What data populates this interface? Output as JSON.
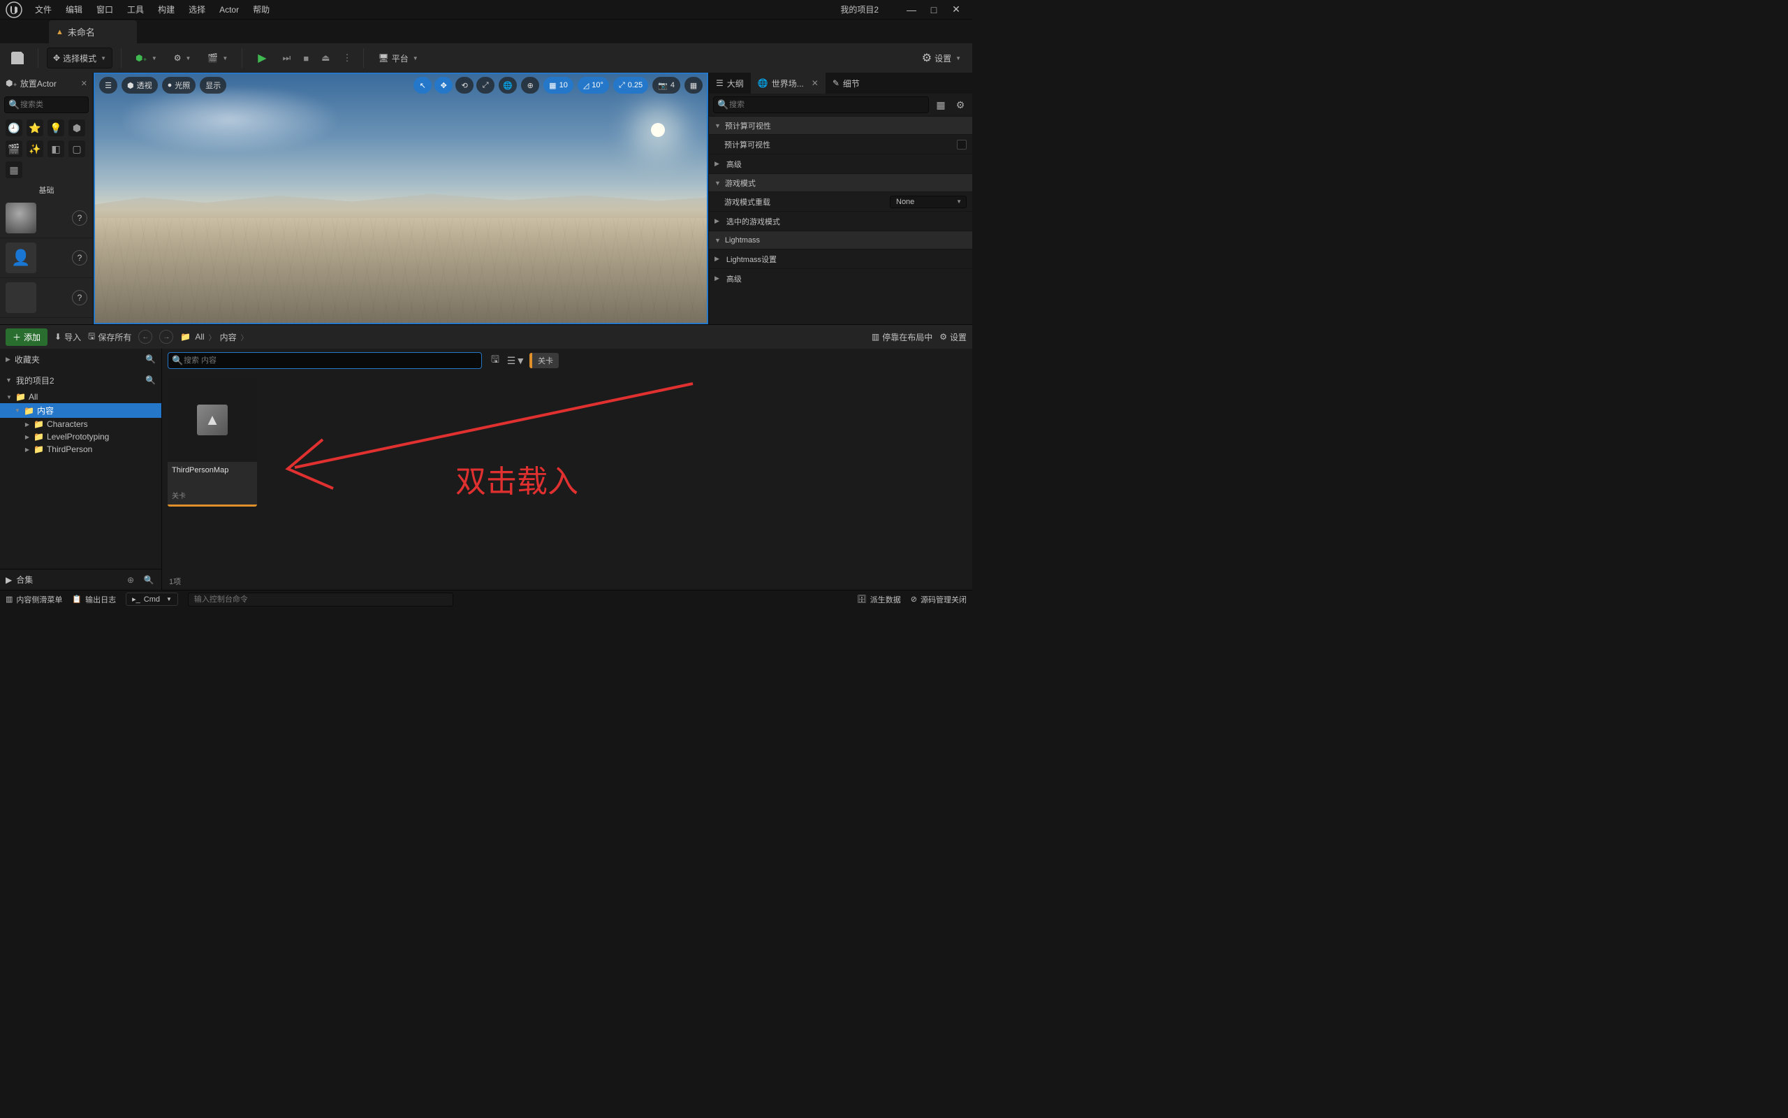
{
  "window": {
    "title": "我的项目2"
  },
  "menu": {
    "file": "文件",
    "edit": "编辑",
    "window": "窗口",
    "tools": "工具",
    "build": "构建",
    "select": "选择",
    "actor": "Actor",
    "help": "帮助"
  },
  "doc_tab": {
    "title": "未命名"
  },
  "toolbar": {
    "select_mode": "选择模式",
    "platform": "平台",
    "settings": "设置"
  },
  "viewport": {
    "perspective": "透视",
    "lighting": "光照",
    "show": "显示",
    "snap_grid": "10",
    "snap_angle": "10°",
    "snap_scale": "0.25",
    "cam_speed": "4"
  },
  "place_actors": {
    "tab": "放置Actor",
    "search_placeholder": "搜索类",
    "basic": "基础"
  },
  "outliner": {
    "tab_outliner": "大纲",
    "tab_world": "世界场...",
    "tab_details": "细节",
    "search_placeholder": "搜索",
    "sections": {
      "precomputed_vis": "预计算可视性",
      "precomputed_vis_prop": "预计算可视性",
      "advanced1": "高级",
      "game_mode": "游戏模式",
      "game_mode_override": "游戏模式重载",
      "game_mode_override_val": "None",
      "selected_game_mode": "选中的游戏模式",
      "lightmass": "Lightmass",
      "lightmass_settings": "Lightmass设置",
      "advanced2": "高级"
    }
  },
  "content_browser": {
    "add": "添加",
    "import": "导入",
    "save_all": "保存所有",
    "bc_all": "All",
    "bc_content": "内容",
    "dock": "停靠在布局中",
    "settings": "设置",
    "favorites": "收藏夹",
    "project": "我的项目2",
    "tree": {
      "all": "All",
      "content": "内容",
      "characters": "Characters",
      "level_proto": "LevelPrototyping",
      "third_person": "ThirdPerson"
    },
    "collections": "合集",
    "search_placeholder": "搜索 内容",
    "filter_chip": "关卡",
    "asset": {
      "name": "ThirdPersonMap",
      "type": "关卡"
    },
    "status": "1项"
  },
  "annotation": {
    "text": "双击载入"
  },
  "statusbar": {
    "content_drawer": "内容侧滑菜单",
    "output_log": "输出日志",
    "cmd": "Cmd",
    "cmd_placeholder": "输入控制台命令",
    "derived_data": "派生数据",
    "source_control": "源码管理关闭"
  }
}
